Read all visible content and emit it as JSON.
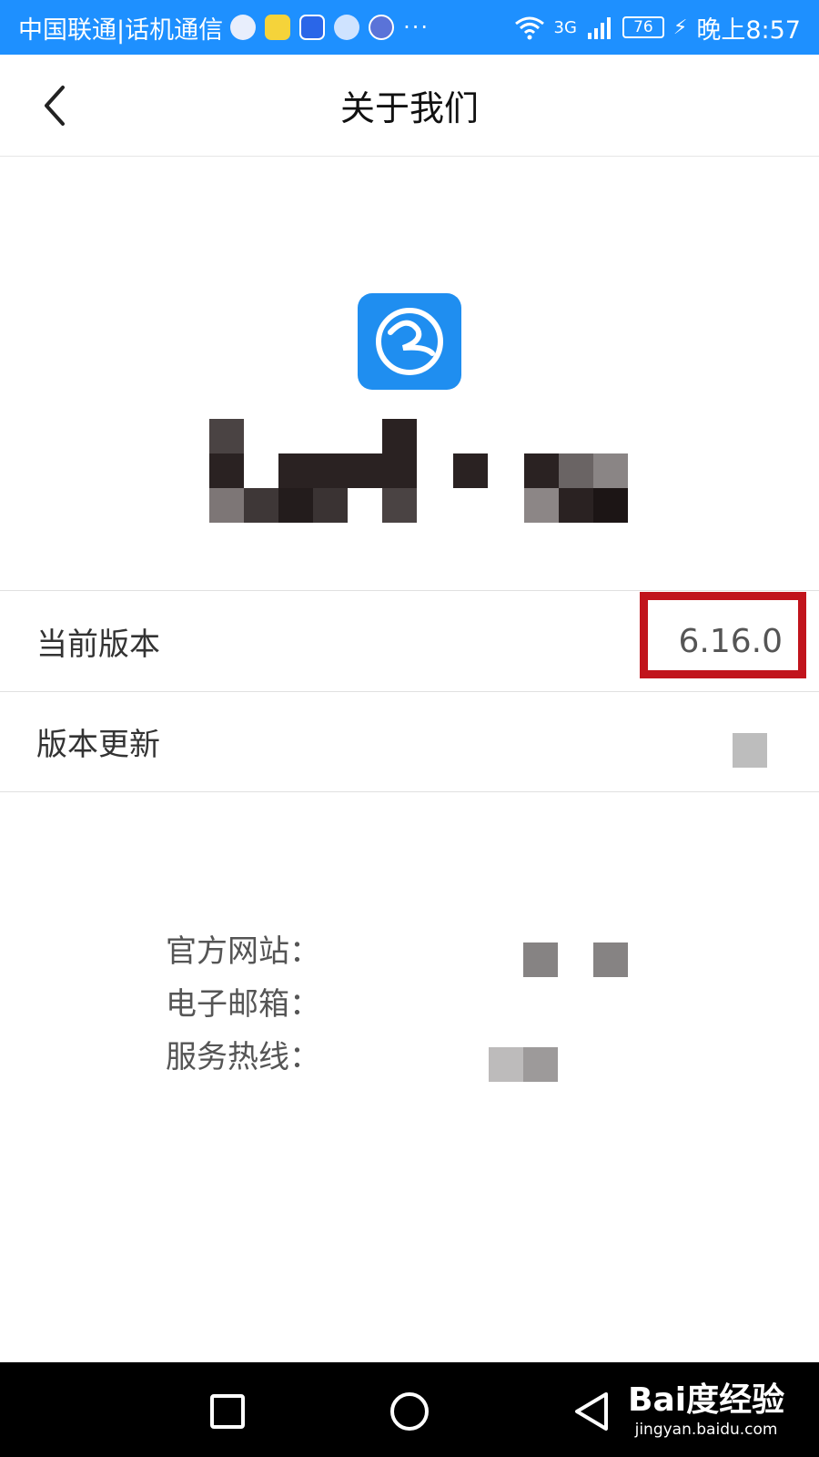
{
  "status_bar": {
    "carrier": "中国联通|话机通信",
    "network": "3G",
    "battery": "76",
    "time": "晚上8:57",
    "app_icons": [
      "app-icon-1",
      "app-icon-2",
      "lightbulb-icon",
      "chat-bubble-icon",
      "clock-app-icon"
    ],
    "overflow": "···"
  },
  "header": {
    "title": "关于我们"
  },
  "app": {
    "logo_color": "#1f8ef0"
  },
  "rows": {
    "current_version_label": "当前版本",
    "current_version_value": "6.16.0",
    "update_label": "版本更新"
  },
  "contact": {
    "website_label": "官方网站：",
    "email_label": "电子邮箱：",
    "hotline_label": "服务热线："
  },
  "watermark": {
    "logo": "Bai度经验",
    "url": "jingyan.baidu.com"
  },
  "colors": {
    "status_bar": "#1e90ff",
    "highlight": "#c1141c",
    "nav_bar": "#000000"
  }
}
